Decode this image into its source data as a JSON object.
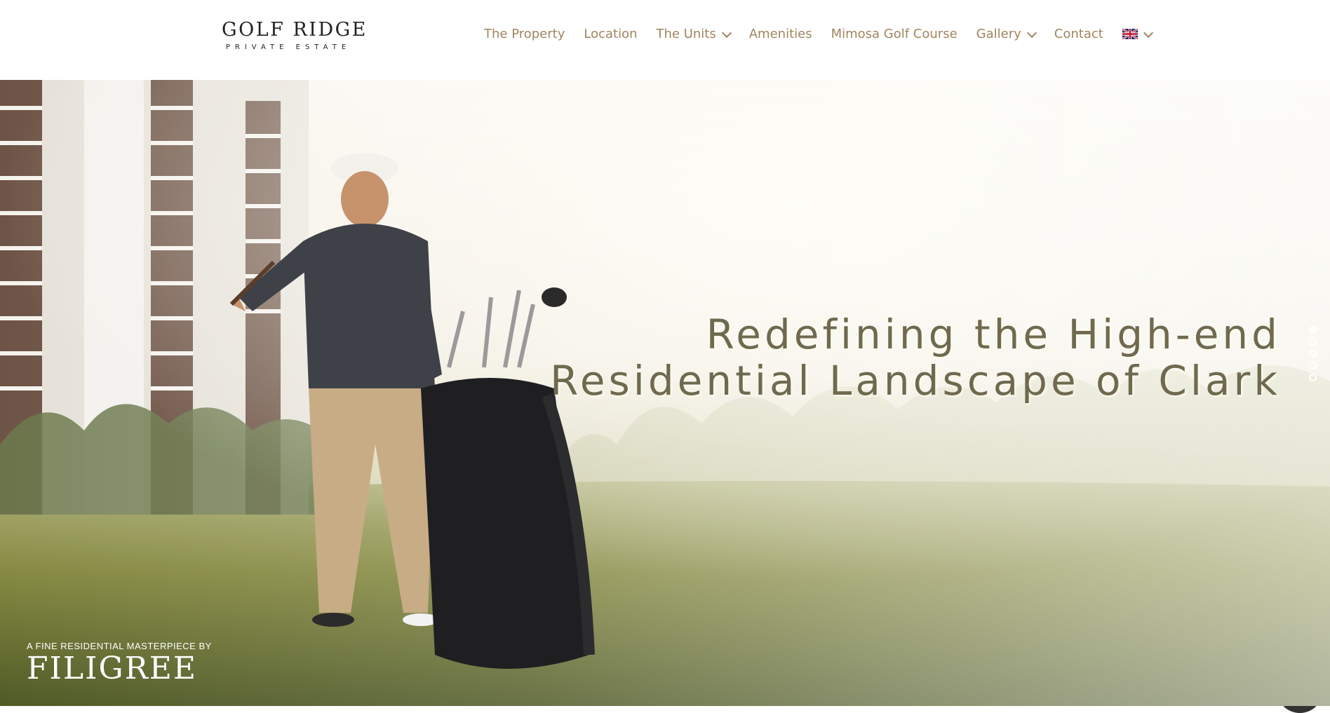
{
  "brand": {
    "name": "GOLF RIDGE",
    "tagline": "PRIVATE ESTATE"
  },
  "nav": {
    "items": [
      {
        "label": "The Property",
        "has_dropdown": false
      },
      {
        "label": "Location",
        "has_dropdown": false
      },
      {
        "label": "The Units",
        "has_dropdown": true
      },
      {
        "label": "Amenities",
        "has_dropdown": false
      },
      {
        "label": "Mimosa Golf Course",
        "has_dropdown": false
      },
      {
        "label": "Gallery",
        "has_dropdown": true
      },
      {
        "label": "Contact",
        "has_dropdown": false
      }
    ],
    "language_icon": "uk-flag-icon"
  },
  "hero": {
    "headline_line1": "Redefining the High-end",
    "headline_line2": "Residential Landscape of Clark",
    "slides_total": 5,
    "active_slide": 1
  },
  "developer": {
    "tagline": "A FINE RESIDENTIAL MASTERPIECE BY",
    "name": "FILIGREE"
  },
  "colors": {
    "nav_text": "#a0855f",
    "headline": "#6f6a4f",
    "chat_bg": "#333333"
  }
}
